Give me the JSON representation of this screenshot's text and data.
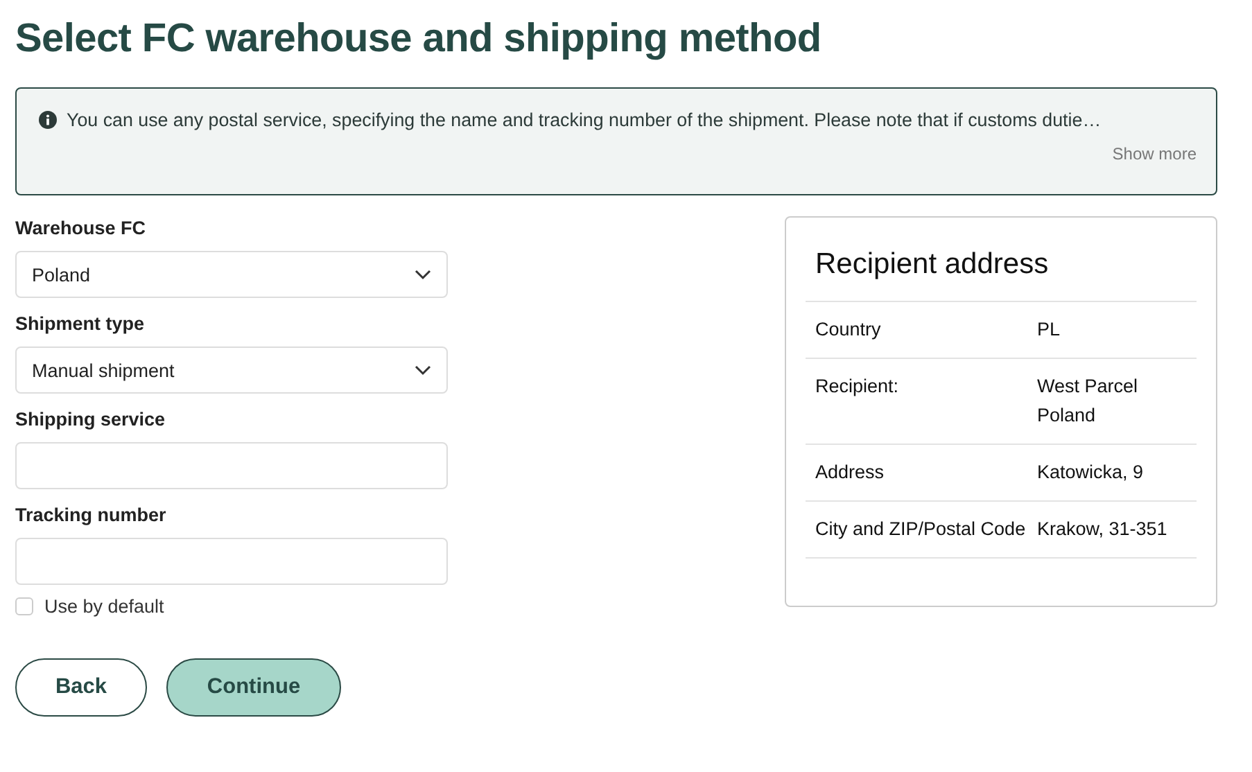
{
  "title": "Select FC warehouse and shipping method",
  "notice": {
    "text": "You can use any postal service, specifying the name and tracking number of the shipment. Please note that if customs dutie…",
    "link": "Show more"
  },
  "fields": [
    {
      "kind": "select",
      "label": "Warehouse FC",
      "value": "Poland"
    },
    {
      "kind": "select",
      "label": "Shipment type",
      "value": "Manual shipment"
    },
    {
      "kind": "text",
      "label": "Shipping service"
    },
    {
      "kind": "text",
      "label": "Tracking number"
    }
  ],
  "use_by_default": {
    "label": "Use by default",
    "checked": false
  },
  "buttons": [
    {
      "kind": "secondary",
      "label": "Back"
    },
    {
      "kind": "primary",
      "label": "Continue"
    }
  ],
  "recipient": {
    "title": "Recipient address",
    "rows": [
      {
        "label": "Country",
        "value": "PL"
      },
      {
        "label": "Recipient:",
        "value": "West Parcel Poland"
      },
      {
        "label": "Address",
        "value": "Katowicka, 9"
      },
      {
        "label": "City and ZIP/Postal Code",
        "value": "Krakow, 31-351"
      }
    ]
  }
}
